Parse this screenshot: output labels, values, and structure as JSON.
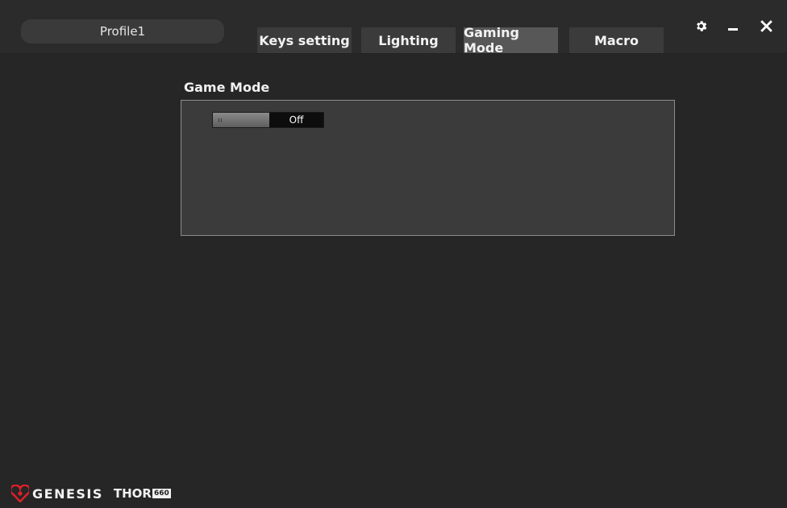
{
  "header": {
    "profile_name": "Profile1",
    "tabs": [
      {
        "label": "Keys setting",
        "active": false
      },
      {
        "label": "Lighting",
        "active": false
      },
      {
        "label": "Gaming Mode",
        "active": true
      },
      {
        "label": "Macro",
        "active": false
      }
    ],
    "window_buttons": [
      "gear-icon",
      "minimize-icon",
      "close-icon"
    ]
  },
  "main": {
    "section_title": "Game Mode",
    "game_mode_toggle": {
      "state_label": "Off",
      "on": false
    }
  },
  "footer": {
    "brand": "GENESIS",
    "product": "THOR",
    "model": "660"
  },
  "colors": {
    "background": "#262626",
    "panel": "#3b3b3b",
    "tab": "#3b3b3b",
    "active_tab": "#575757",
    "logo_red": "#e0202a"
  }
}
